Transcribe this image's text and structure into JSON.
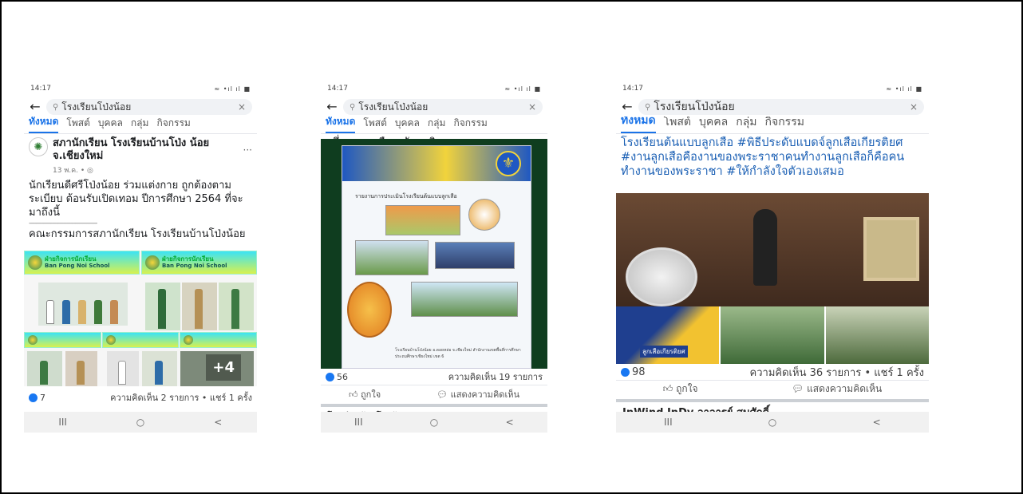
{
  "screens": [
    {
      "time": "14:17",
      "status_icons": "≈ •ıl ıl ■",
      "search": {
        "query": "โรงเรียนโป่งน้อย"
      },
      "tabs": [
        "ทั้งหมด",
        "โพสต์",
        "บุคคล",
        "กลุ่ม",
        "กิจกรรม"
      ],
      "active_tab": 0,
      "post": {
        "page_name": "สภานักเรียน โรงเรียนบ้านโป่ง น้อย จ.เชียงใหม่",
        "meta": "13 พ.ค. • ◎",
        "text": "นักเรียนดีศรีโป่งน้อย ร่วมแต่งกาย ถูกต้องตามระเบียบ ต้อนรับเปิดเทอม ปีการศึกษา 2564 ที่จะมาถึงนี้",
        "divider": "--------------------------------------",
        "text2": "คณะกรรมการสภานักเรียน โรงเรียนบ้านโป่งน้อย",
        "banner_th": "ฝ่ายกิจการนักเรียน",
        "banner_en": "Ban Pong Noi School",
        "more_photos": "+4",
        "likes": "7",
        "comments_shares": "ความคิดเห็น 2 รายการ • แชร์ 1 ครั้ง"
      },
      "nav": [
        "III",
        "○",
        "<"
      ]
    },
    {
      "time": "14:17",
      "status_icons": "≈ •ıl ıl ■",
      "search": {
        "query": "โรงเรียนโป่งน้อย"
      },
      "tabs": [
        "ทั้งหมด",
        "โพสต์",
        "บุคคล",
        "กลุ่ม",
        "กิจกรรม"
      ],
      "active_tab": 0,
      "post": {
        "text": "หนึ่งงานลูกเสือระดับชาติ",
        "poster_title": "รายงานการประเมินโรงเรียนต้นแบบลูกเสือ",
        "poster_footer": "โรงเรียนบ้านโป่งน้อย อ.ดอยหล่อ จ.เชียงใหม่ สำนักงานเขตพื้นที่การศึกษาประถมศึกษาเชียงใหม่ เขต 6",
        "likes": "56",
        "comments": "ความคิดเห็น 19 รายการ",
        "like_action": "ถูกใจ",
        "comment_action": "แสดงความคิดเห็น",
        "next_peek": "โรงเรียนบ้านโป่งน้อย"
      },
      "nav": [
        "III",
        "○",
        "<"
      ]
    },
    {
      "time": "14:17",
      "status_icons": "≈ •ıl ıl ■",
      "search": {
        "query": "โรงเรียนโป่งน้อย"
      },
      "tabs": [
        "ทั้งหมด",
        "โพสต์",
        "บุคคล",
        "กลุ่ม",
        "กิจกรรม"
      ],
      "active_tab": 0,
      "post": {
        "text": "โรงเรียนต้นแบบลูกเสือ #พิธีประดับแบดจ์ลูกเสือเกียรติยศ #งานลูกเสือคืองานของพระราชาคนทำงานลูกเสือก็คือคนทำงานของพระราชา #ให้กำลังใจตัวเองเสมอ",
        "badge_text": "ลูกเสือเกียรติยศ",
        "likes": "98",
        "comments_shares": "ความคิดเห็น 36 รายการ • แชร์ 1 ครั้ง",
        "like_action": "ถูกใจ",
        "comment_action": "แสดงความคิดเห็น",
        "next_peek": "InWind InDy อาจารย์ สมศักดิ์"
      },
      "nav": [
        "III",
        "○",
        "<"
      ]
    }
  ],
  "colors": {
    "accent": "#1a73e8",
    "like_blue": "#1877f2",
    "poster_green": "#0f3d1f"
  }
}
